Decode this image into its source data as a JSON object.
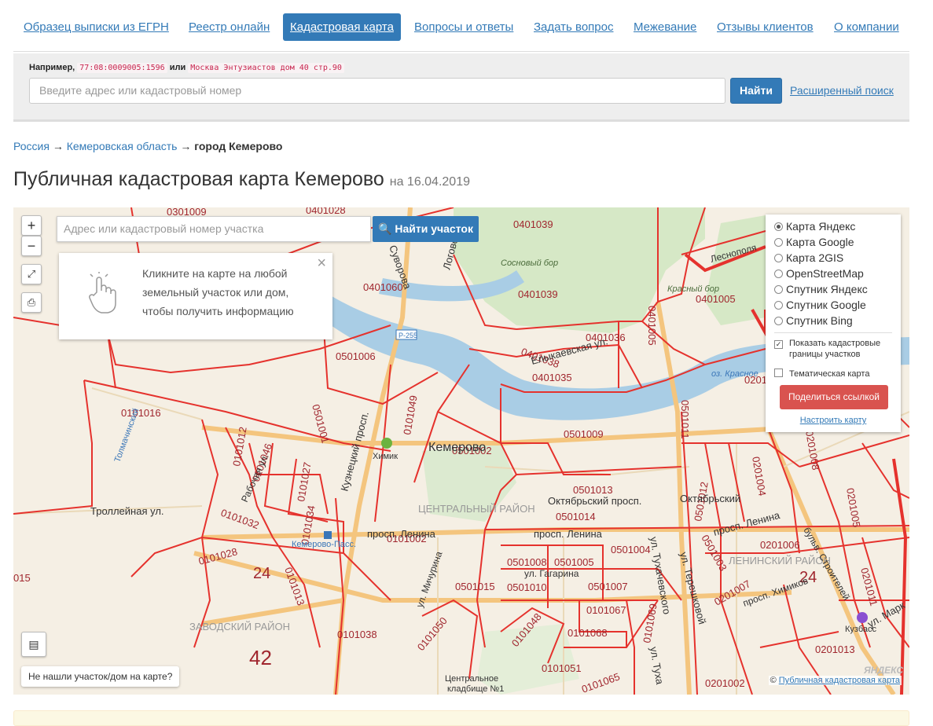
{
  "nav": {
    "items": [
      {
        "label": "Образец выписки из ЕГРН",
        "active": false
      },
      {
        "label": "Реестр онлайн",
        "active": false
      },
      {
        "label": "Кадастровая карта",
        "active": true
      },
      {
        "label": "Вопросы и ответы",
        "active": false
      },
      {
        "label": "Задать вопрос",
        "active": false
      },
      {
        "label": "Межевание",
        "active": false
      },
      {
        "label": "Отзывы клиентов",
        "active": false
      },
      {
        "label": "О компании",
        "active": false
      }
    ]
  },
  "search": {
    "example_prefix": "Например,",
    "example_code1": "77:08:0009005:1596",
    "example_or": "или",
    "example_code2": "Москва Энтузиастов дом 40 стр.90",
    "placeholder": "Введите адрес или кадастровый номер",
    "button": "Найти",
    "advanced": "Расширенный поиск"
  },
  "breadcrumb": {
    "country": "Россия",
    "arrow1": "→",
    "region": "Кемеровская область",
    "arrow2": "→",
    "city": "город Кемерово"
  },
  "title": {
    "main": "Публичная кадастровая карта Кемерово",
    "date": "на 16.04.2019"
  },
  "map": {
    "zoom_in": "+",
    "zoom_out": "−",
    "search_placeholder": "Адрес или кадастровый номер участка",
    "search_button": "Найти участок",
    "hint": "Кликните на карте на любой земельный участок или дом, чтобы получить информацию",
    "hint_close": "×",
    "not_found": "Не нашли участок/дом на карте?",
    "attribution_prefix": "©",
    "attribution_link": "Публичная кадастровая карта",
    "yandex_logo": "ЯНДЕКС",
    "layers": [
      {
        "label": "Карта Яндекс",
        "selected": true
      },
      {
        "label": "Карта Google",
        "selected": false
      },
      {
        "label": "Карта 2GIS",
        "selected": false
      },
      {
        "label": "OpenStreetMap",
        "selected": false
      },
      {
        "label": "Спутник Яндекс",
        "selected": false
      },
      {
        "label": "Спутник Google",
        "selected": false
      },
      {
        "label": "Спутник Bing",
        "selected": false
      }
    ],
    "show_boundaries": {
      "line1": "Показать кадастровые",
      "line2": "границы участков",
      "checked": true
    },
    "thematic": {
      "label": "Тематическая карта",
      "checked": false
    },
    "share_button": "Поделиться ссылкой",
    "setup_link": "Настроить карту",
    "labels": {
      "q0301009": "0301009",
      "q0401028": "0401028",
      "q0401039a": "0401039",
      "q0401039b": "0401039",
      "q0401060": "0401060",
      "q0401036": "0401036",
      "q0401038": "0401038",
      "q0401035": "0401035",
      "q0401005": "0401005",
      "q0501006": "0501006",
      "q0101016": "0101016",
      "q0101012": "0101012",
      "q0101046": "0101046",
      "q0101027": "0101027",
      "q0501001": "0501001",
      "q0101049": "0101049",
      "q0501002": "0501002",
      "q0501009": "0501009",
      "q0501013": "0501013",
      "q0501014": "0501014",
      "q0101032": "0101032",
      "q0101034": "0101034",
      "q0101002": "0101002",
      "q0101028": "0101028",
      "q0101013": "0101013",
      "q0501008": "0501008",
      "q0501005": "0501005",
      "q0501015": "0501015",
      "q0501010": "0501010",
      "q0501007": "0501007",
      "q0501004": "0501004",
      "q0101038": "0101038",
      "q0101050": "0101050",
      "q0101048": "0101048",
      "q0101067": "0101067",
      "q0101068": "0101068",
      "q0101051": "0101051",
      "q0101065": "0101065",
      "q0101069": "0101069",
      "q0401005v": "0401005",
      "q0501011": "0501011",
      "q0501012": "0501012",
      "q0501003": "0501003",
      "q0201007": "0201007",
      "q0201002": "0201002",
      "q0201006": "0201006",
      "q0201008": "0201008",
      "q0201004": "0201004",
      "q0201005": "0201005",
      "q0201011": "0201011",
      "q0201013": "0201013",
      "q0201": "0201",
      "q015": "015",
      "n24a": "24",
      "n24b": "24",
      "n42": "42",
      "city": "Кемерово",
      "district_center": "ЦЕНТРАЛЬНЫЙ РАЙОН",
      "district_zavod": "ЗАВОДСКИЙ РАЙОН",
      "district_lenin": "ЛЕНИНСКИЙ РАЙОН",
      "forest1": "Сосновый бор",
      "forest2": "Красный бор",
      "street_suvorova": "Суворова",
      "street_dogova": "Логовой",
      "street_elykaev": "Елыкаевская ул.",
      "street_lesnopol": "Леснополя",
      "street_kuzn": "Кузнецкий просп.",
      "street_oktyabr": "Октябрьский просп.",
      "street_oktyabr2": "Октябрьский",
      "street_lenina": "просп. Ленина",
      "street_lenina2": "просп. Ленина",
      "street_lenina3": "просп. Ленина",
      "street_trolley": "Троллейная ул.",
      "street_rabochaya": "Рабочая ул.",
      "street_michurina": "ул. Мичурина",
      "street_gagarina": "ул. Гагарина",
      "street_tukh": "ул. Тухачевского",
      "street_tukh2": "ул. Туха",
      "street_tereshk": "ул. Терешковой",
      "street_khimikov": "просп. Химиков",
      "street_stroitel": "бульв. Строителей",
      "street_tolmach": "Толмачинский",
      "street_marks": "ул. Марк",
      "krasn_oz": "оз. Красное",
      "poi_himik": "Химик",
      "poi_station": "Кемерово-Пасс.",
      "poi_kuzbass": "Кузбасс",
      "poi_cemetery1": "Центральное",
      "poi_cemetery2": "кладбище №1",
      "road_r255": "Р-255"
    }
  }
}
